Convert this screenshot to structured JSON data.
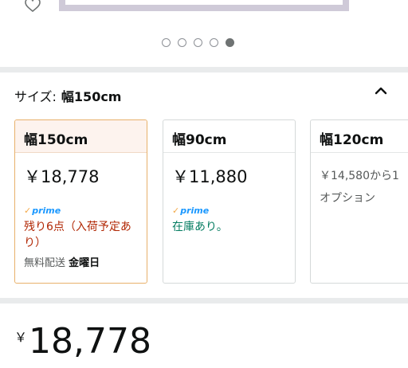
{
  "carousel": {
    "dot_count": 5,
    "active_index": 4
  },
  "size_selector": {
    "label": "サイズ:",
    "selected_value": "幅150cm",
    "options": [
      {
        "name": "幅150cm",
        "price": "￥18,778",
        "prime": "prime",
        "stock": "残り6点（入荷予定あり）",
        "delivery_label": "無料配送",
        "delivery_day": "金曜日",
        "selected": true
      },
      {
        "name": "幅90cm",
        "price": "￥11,880",
        "prime": "prime",
        "stock": "在庫あり。"
      },
      {
        "name": "幅120cm",
        "price": "￥14,580から1",
        "option_text": "オプション"
      }
    ]
  },
  "price": {
    "symbol": "￥",
    "amount": "18,778"
  },
  "colors": {
    "selected_border": "#e8b16b",
    "prime_blue": "#1a98ff",
    "stock_orange": "#b12704",
    "stock_green": "#067d62"
  }
}
